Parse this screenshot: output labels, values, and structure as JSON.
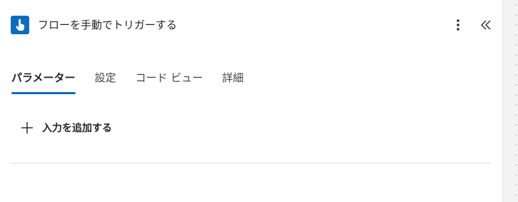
{
  "header": {
    "title": "フローを手動でトリガーする",
    "trigger_icon": "touch-hand-icon",
    "more_icon": "more-vertical-icon",
    "collapse_icon": "chevron-double-left-icon"
  },
  "tabs": [
    {
      "label": "パラメーター",
      "active": true
    },
    {
      "label": "設定",
      "active": false
    },
    {
      "label": "コード ビュー",
      "active": false
    },
    {
      "label": "詳細",
      "active": false
    }
  ],
  "add_input": {
    "label": "入力を追加する",
    "icon": "plus-icon"
  },
  "colors": {
    "accent": "#0f6cbd",
    "text": "#242424",
    "divider": "#e0e0e0"
  }
}
